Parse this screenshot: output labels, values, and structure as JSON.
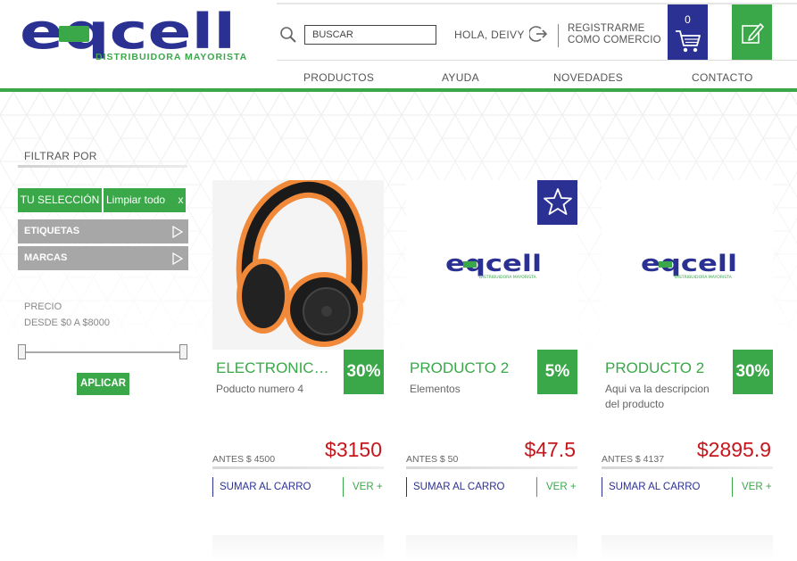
{
  "brand": {
    "logo_text": "eqcell",
    "subtitle": "DISTRIBUIDORA MAYORISTA"
  },
  "colors": {
    "brand_blue": "#2b3192",
    "brand_green": "#3aa849",
    "price_red": "#c4161c",
    "filter_gray": "#a7a7a7"
  },
  "header": {
    "search_placeholder": "BUSCAR",
    "greeting": "HOLA, DEIVY",
    "register_line1": "REGISTRARME",
    "register_line2": "COMO COMERCIO",
    "cart_count": "0"
  },
  "nav": [
    "PRODUCTOS",
    "AYUDA",
    "NOVEDADES",
    "CONTACTO"
  ],
  "sidebar": {
    "filter_title": "FILTRAR POR",
    "selection_label": "TU SELECCIÓN",
    "clear_label": "Limpiar todo",
    "clear_x": "x",
    "accordions": [
      "ETIQUETAS",
      "MARCAS"
    ],
    "price_label": "PRECIO",
    "price_range": "DESDE $0 A $8000",
    "apply_label": "APLICAR"
  },
  "products": [
    {
      "title": "ELECTRONICA...",
      "discount": "30%",
      "description": "Poducto numero 4",
      "old_price": "ANTES $ 4500",
      "price": "$3150",
      "add_label": "SUMAR AL CARRO",
      "view_label": "VER +",
      "image": "headphones-photo"
    },
    {
      "title": "PRODUCTO 2",
      "discount": "5%",
      "description": "Elementos",
      "old_price": "ANTES $ 50",
      "price": "$47.5",
      "add_label": "SUMAR AL CARRO",
      "view_label": "VER +",
      "image": "eqcell-logo",
      "favorite": true
    },
    {
      "title": "PRODUCTO 2",
      "discount": "30%",
      "description": "Aqui va la descripcion del producto",
      "old_price": "ANTES $ 4137",
      "price": "$2895.9",
      "add_label": "SUMAR AL CARRO",
      "view_label": "VER +",
      "image": "eqcell-logo"
    }
  ]
}
